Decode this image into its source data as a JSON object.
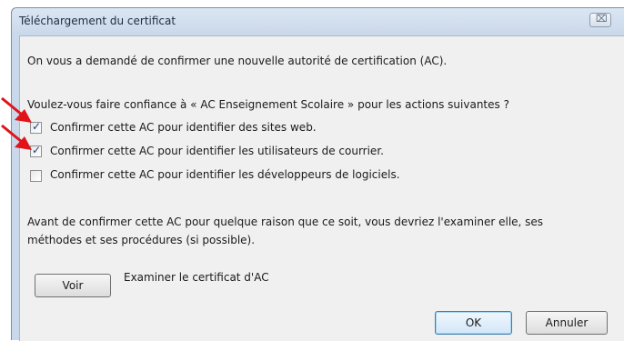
{
  "window": {
    "title": "Téléchargement du certificat",
    "close_glyph": "⌧"
  },
  "dialog": {
    "intro": "On vous a demandé de confirmer une nouvelle autorité de certification (AC).",
    "question": "Voulez-vous faire confiance à « AC Enseignement Scolaire » pour les actions suivantes ?",
    "options": [
      {
        "label": "Confirmer cette AC pour identifier des sites web.",
        "checked": true
      },
      {
        "label": "Confirmer cette AC pour identifier les utilisateurs de courrier.",
        "checked": true
      },
      {
        "label": "Confirmer cette AC pour identifier les développeurs de logiciels.",
        "checked": false
      }
    ],
    "warning_line1": "Avant de confirmer cette AC pour quelque raison que ce soit, vous devriez l'examiner elle, ses",
    "warning_line2": "méthodes et ses procédures (si possible).",
    "view_button": "Voir",
    "view_caption": "Examiner le certificat d'AC",
    "ok_button": "OK",
    "cancel_button": "Annuler"
  },
  "colors": {
    "annotation_arrow": "#e0141b",
    "check_mark": "#1b3f78"
  }
}
